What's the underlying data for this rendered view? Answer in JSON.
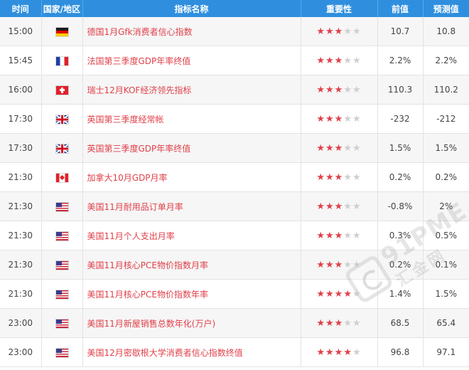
{
  "headers": {
    "time": "时间",
    "country": "国家/地区",
    "indicator": "指标名称",
    "importance": "重要性",
    "previous": "前值",
    "forecast": "预测值"
  },
  "colors": {
    "header_bg": "#2f8fde",
    "indicator_text": "#e0404a",
    "star_on": "#e0404a",
    "star_off": "#cfcfcf",
    "row_alt_bg": "#f6f6f6"
  },
  "rows": [
    {
      "time": "15:00",
      "flag": "de",
      "country": "germany-flag-icon",
      "indicator": "德国1月Gfk消费者信心指数",
      "stars": 3,
      "previous": "10.7",
      "forecast": "10.8"
    },
    {
      "time": "15:45",
      "flag": "fr",
      "country": "france-flag-icon",
      "indicator": "法国第三季度GDP年率终值",
      "stars": 3,
      "previous": "2.2%",
      "forecast": "2.2%"
    },
    {
      "time": "16:00",
      "flag": "ch",
      "country": "switzerland-flag-icon",
      "indicator": "瑞士12月KOF经济领先指标",
      "stars": 3,
      "previous": "110.3",
      "forecast": "110.2"
    },
    {
      "time": "17:30",
      "flag": "gb",
      "country": "uk-flag-icon",
      "indicator": "英国第三季度经常帐",
      "stars": 3,
      "previous": "-232",
      "forecast": "-212"
    },
    {
      "time": "17:30",
      "flag": "gb",
      "country": "uk-flag-icon",
      "indicator": "英国第三季度GDP年率终值",
      "stars": 3,
      "previous": "1.5%",
      "forecast": "1.5%"
    },
    {
      "time": "21:30",
      "flag": "ca",
      "country": "canada-flag-icon",
      "indicator": "加拿大10月GDP月率",
      "stars": 3,
      "previous": "0.2%",
      "forecast": "0.2%"
    },
    {
      "time": "21:30",
      "flag": "us",
      "country": "us-flag-icon",
      "indicator": "美国11月耐用品订单月率",
      "stars": 3,
      "previous": "-0.8%",
      "forecast": "2%"
    },
    {
      "time": "21:30",
      "flag": "us",
      "country": "us-flag-icon",
      "indicator": "美国11月个人支出月率",
      "stars": 3,
      "previous": "0.3%",
      "forecast": "0.5%"
    },
    {
      "time": "21:30",
      "flag": "us",
      "country": "us-flag-icon",
      "indicator": "美国11月核心PCE物价指数月率",
      "stars": 3,
      "previous": "0.2%",
      "forecast": "0.1%"
    },
    {
      "time": "21:30",
      "flag": "us",
      "country": "us-flag-icon",
      "indicator": "美国11月核心PCE物价指数年率",
      "stars": 4,
      "previous": "1.4%",
      "forecast": "1.5%"
    },
    {
      "time": "23:00",
      "flag": "us",
      "country": "us-flag-icon",
      "indicator": "美国11月新屋销售总数年化(万户)",
      "stars": 3,
      "previous": "68.5",
      "forecast": "65.4"
    },
    {
      "time": "23:00",
      "flag": "us",
      "country": "us-flag-icon",
      "indicator": "美国12月密歇根大学消费者信心指数终值",
      "stars": 4,
      "previous": "96.8",
      "forecast": "97.1"
    }
  ],
  "watermark": {
    "text": "91PME.COM",
    "sub": "汇金网"
  }
}
